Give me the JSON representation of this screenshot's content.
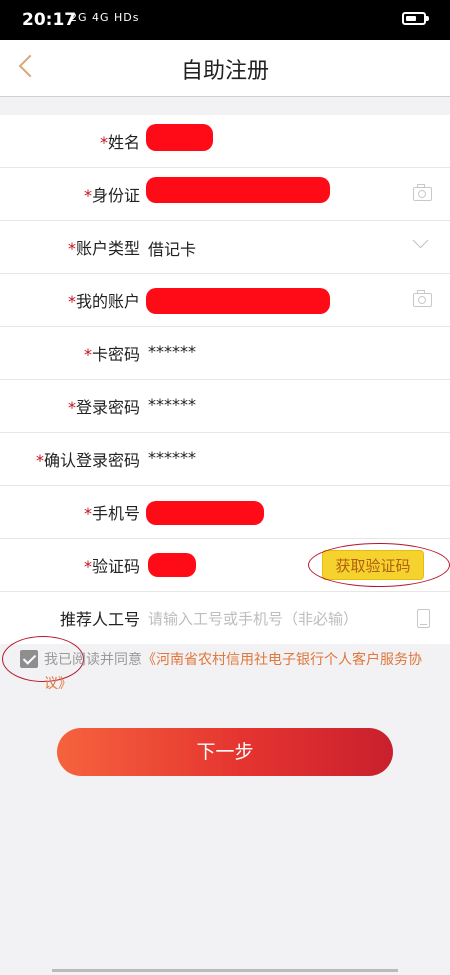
{
  "status_bar": {
    "time": "20:17",
    "signal_text": "2G 4G HDs"
  },
  "header": {
    "title": "自助注册"
  },
  "form": {
    "rows": [
      {
        "label": "姓名",
        "required": true
      },
      {
        "label": "身份证",
        "required": true
      },
      {
        "label": "账户类型",
        "required": true,
        "value": "借记卡"
      },
      {
        "label": "我的账户",
        "required": true
      },
      {
        "label": "卡密码",
        "required": true,
        "value": "******"
      },
      {
        "label": "登录密码",
        "required": true,
        "value": "******"
      },
      {
        "label": "确认登录密码",
        "required": true,
        "value": "******"
      },
      {
        "label": "手机号",
        "required": true
      },
      {
        "label": "验证码",
        "required": true,
        "button": "获取验证码"
      },
      {
        "label": "推荐人工号",
        "required": false,
        "placeholder": "请输入工号或手机号（非必输）"
      }
    ],
    "required_mark": "*"
  },
  "agreement": {
    "checked": true,
    "text": "我已阅读并同意",
    "link": "《河南省农村信用社电子银行个人客户服务协议》"
  },
  "next_button": {
    "label": "下一步"
  },
  "colors": {
    "required": "#c2131c",
    "redaction": "#ff0a17",
    "button_gradient_start": "#f5633d",
    "button_gradient_end": "#c9202e",
    "code_button": "#f6d22e",
    "link": "#e0773b"
  }
}
